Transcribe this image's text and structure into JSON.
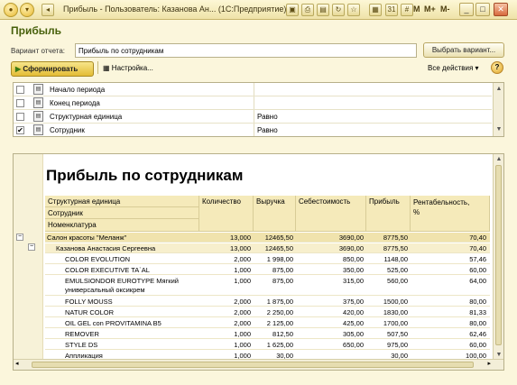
{
  "window": {
    "title": "Прибыль - Пользователь: Казанова Ан... (1С:Предприятие)",
    "m_labels": [
      "M",
      "M+",
      "M-"
    ]
  },
  "page": {
    "heading": "Прибыль",
    "variant_label": "Вариант отчета:",
    "variant_value": "Прибыль по сотрудникам",
    "select_variant_button": "Выбрать вариант..."
  },
  "toolbar": {
    "generate_button": "Сформировать",
    "settings_button": "Настройка...",
    "all_actions": "Все действия",
    "help": "?"
  },
  "filters": [
    {
      "checked": false,
      "name": "Начало периода",
      "condition": ""
    },
    {
      "checked": false,
      "name": "Конец периода",
      "condition": ""
    },
    {
      "checked": false,
      "name": "Структурная единица",
      "condition": "Равно"
    },
    {
      "checked": true,
      "name": "Сотрудник",
      "condition": "Равно"
    }
  ],
  "report": {
    "title": "Прибыль по сотрудникам",
    "group_headers": [
      "Структурная единица",
      "Сотрудник",
      "Номенклатура"
    ],
    "columns": [
      "Количество",
      "Выручка",
      "Себестоимость",
      "Прибыль",
      "Рентабельность,",
      "%"
    ],
    "rows": [
      {
        "level": 0,
        "name": "Салон красоты \"Меланж\"",
        "qty": "13,000",
        "revenue": "12465,50",
        "cost": "3690,00",
        "profit": "8775,50",
        "margin": "70,40"
      },
      {
        "level": 1,
        "name": "Казанова Анастасия Сергеевна",
        "qty": "13,000",
        "revenue": "12465,50",
        "cost": "3690,00",
        "profit": "8775,50",
        "margin": "70,40"
      },
      {
        "level": 2,
        "name": "COLOR EVOLUTION",
        "qty": "2,000",
        "revenue": "1 998,00",
        "cost": "850,00",
        "profit": "1148,00",
        "margin": "57,46"
      },
      {
        "level": 2,
        "name": "COLOR EXECUTIVE TA`AL",
        "qty": "1,000",
        "revenue": "875,00",
        "cost": "350,00",
        "profit": "525,00",
        "margin": "60,00"
      },
      {
        "level": 2,
        "name": "EMULSIONDOR EUROTYPE Мягкий",
        "name2": "универсальный оксикрем",
        "qty": "1,000",
        "revenue": "875,00",
        "cost": "315,00",
        "profit": "560,00",
        "margin": "64,00"
      },
      {
        "level": 2,
        "name": "FOLLY MOUSS",
        "qty": "2,000",
        "revenue": "1 875,00",
        "cost": "375,00",
        "profit": "1500,00",
        "margin": "80,00"
      },
      {
        "level": 2,
        "name": "NATUR COLOR",
        "qty": "2,000",
        "revenue": "2 250,00",
        "cost": "420,00",
        "profit": "1830,00",
        "margin": "81,33"
      },
      {
        "level": 2,
        "name": "OIL GEL con PROVITAMINA B5",
        "qty": "2,000",
        "revenue": "2 125,00",
        "cost": "425,00",
        "profit": "1700,00",
        "margin": "80,00"
      },
      {
        "level": 2,
        "name": "REMOVER",
        "qty": "1,000",
        "revenue": "812,50",
        "cost": "305,00",
        "profit": "507,50",
        "margin": "62,46"
      },
      {
        "level": 2,
        "name": "STYLE DS",
        "qty": "1,000",
        "revenue": "1 625,00",
        "cost": "650,00",
        "profit": "975,00",
        "margin": "60,00"
      },
      {
        "level": 2,
        "name": "Аппликация",
        "qty": "1,000",
        "revenue": "30,00",
        "cost": "",
        "profit": "30,00",
        "margin": "100,00"
      }
    ]
  },
  "colors": {
    "heading": "#47600b",
    "group_row": "#f0e3ad",
    "header_bg": "#f5eaba"
  }
}
